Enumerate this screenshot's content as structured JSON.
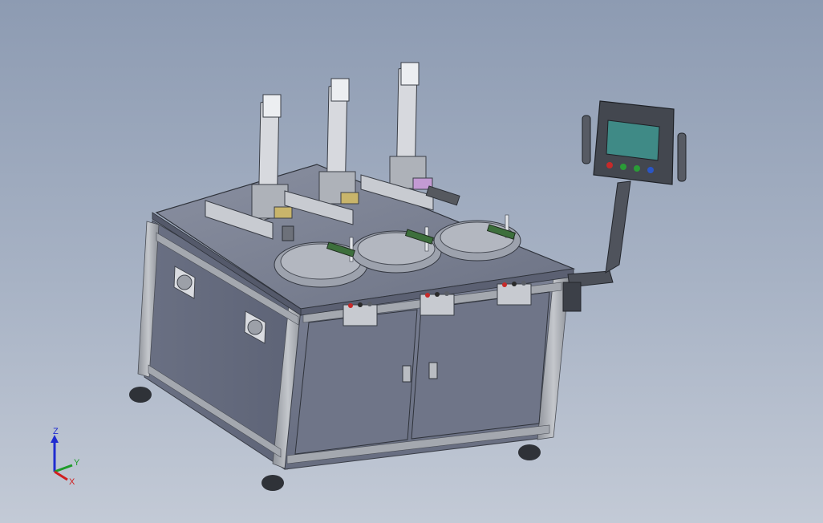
{
  "viewport": {
    "background_top": "#8d9bb2",
    "background_bottom": "#c3cad6"
  },
  "model": {
    "frame_color": "#a6aab1",
    "panel_color": "#6e7587",
    "tabletop_color": "#7c8294",
    "hmi_screen_color": "#3f8a86",
    "hmi_buttons": [
      "red",
      "green",
      "green",
      "blue"
    ],
    "station_count": 3
  },
  "triad": {
    "z_label": "Z",
    "y_label": "Y",
    "x_label": "X",
    "z_color": "#1f2bd0",
    "y_color": "#1e9c2a",
    "x_color": "#d11f1f"
  }
}
